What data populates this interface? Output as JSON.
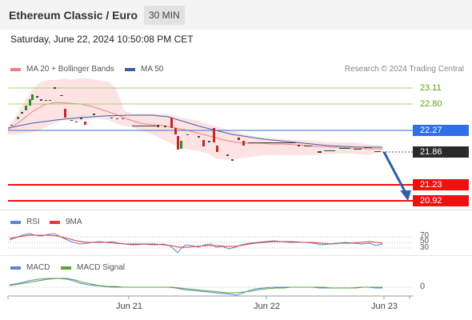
{
  "header": {
    "title": "Ethereum Classic / Euro",
    "timeframe": "30 MIN"
  },
  "datetime": "Saturday, June 22, 2024 10:50:08 PM CET",
  "legend": {
    "ma20_label": "MA 20 + Bollinger Bands",
    "ma50_label": "MA 50",
    "ma20_color": "#f08080",
    "ma50_color": "#3d5fa8",
    "research": "Research © 2024 Trading Central"
  },
  "price_levels": {
    "r2": "23.11",
    "r1": "22.80",
    "pivot": "22.27",
    "last": "21.86",
    "s1": "21.23",
    "s2": "20.92"
  },
  "colors": {
    "pivot_blue": "#2f6fe8",
    "support_red": "#f01010",
    "last_dark": "#2a2a2a",
    "resistance_green": "#6a9a1f",
    "candle_up": "#2e8b2e",
    "candle_down": "#c62828",
    "arrow": "#2f5fa8"
  },
  "rsi": {
    "label": "RSI",
    "ma_label": "9MA",
    "levels": [
      "70",
      "50",
      "30"
    ]
  },
  "macd": {
    "label": "MACD",
    "signal_label": "MACD Signal",
    "zero": "0"
  },
  "xaxis": {
    "labels": [
      "Jun 21",
      "Jun 22",
      "Jun 23"
    ]
  }
}
